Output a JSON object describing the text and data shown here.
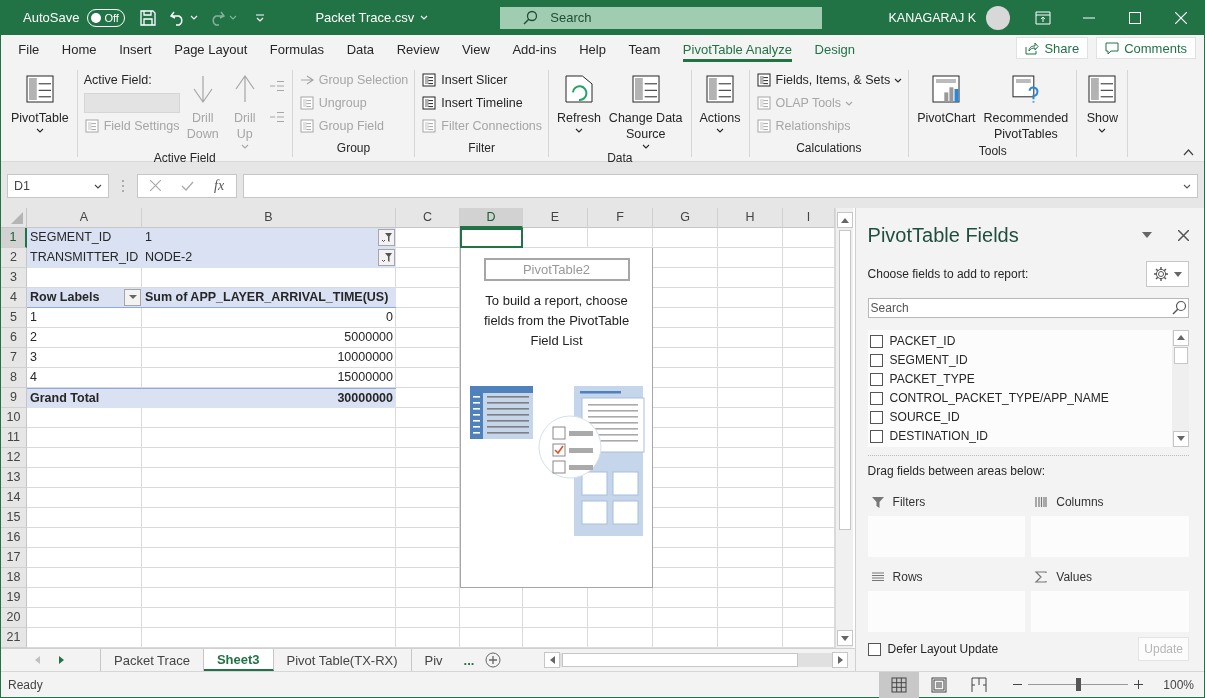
{
  "title_bar": {
    "autosave_label": "AutoSave",
    "autosave": {
      "on": false,
      "label": "Off"
    },
    "redo_disabled": true,
    "file_name": "Packet Trace.csv",
    "search": {
      "placeholder": "Search"
    },
    "user_name": "KANAGARAJ K"
  },
  "menu_tabs": [
    {
      "label": "File",
      "selected": false,
      "contextual": false
    },
    {
      "label": "Home",
      "selected": false,
      "contextual": false
    },
    {
      "label": "Insert",
      "selected": false,
      "contextual": false
    },
    {
      "label": "Page Layout",
      "selected": false,
      "contextual": false
    },
    {
      "label": "Formulas",
      "selected": false,
      "contextual": false
    },
    {
      "label": "Data",
      "selected": false,
      "contextual": false
    },
    {
      "label": "Review",
      "selected": false,
      "contextual": false
    },
    {
      "label": "View",
      "selected": false,
      "contextual": false
    },
    {
      "label": "Add-ins",
      "selected": false,
      "contextual": false
    },
    {
      "label": "Help",
      "selected": false,
      "contextual": false
    },
    {
      "label": "Team",
      "selected": false,
      "contextual": false
    },
    {
      "label": "PivotTable Analyze",
      "selected": true,
      "contextual": true
    },
    {
      "label": "Design",
      "selected": false,
      "contextual": true
    }
  ],
  "share": "Share",
  "comments": "Comments",
  "ribbon": {
    "groups": [
      {
        "columns": [
          [
            {
              "kind": "large",
              "lines": [
                "PivotTable"
              ],
              "dropdown": true,
              "disabled": false
            }
          ]
        ]
      },
      {
        "label": "Active Field",
        "columns": [
          [
            {
              "kind": "label",
              "text": "Active Field:"
            },
            {
              "kind": "input",
              "disabled": true
            },
            {
              "kind": "small",
              "text": "Field Settings",
              "disabled": true
            }
          ],
          [
            {
              "kind": "large",
              "lines": [
                "Drill",
                "Down"
              ],
              "disabled": true
            }
          ],
          [
            {
              "kind": "large",
              "lines": [
                "Drill",
                "Up"
              ],
              "dropdown": true,
              "disabled": true
            }
          ],
          [
            {
              "kind": "icon",
              "disabled": true
            },
            {
              "kind": "icon",
              "disabled": true
            }
          ]
        ]
      },
      {
        "label": "Group",
        "columns": [
          [
            {
              "kind": "small",
              "text": "Group Selection",
              "disabled": true
            },
            {
              "kind": "small",
              "text": "Ungroup",
              "disabled": true
            },
            {
              "kind": "small",
              "text": "Group Field",
              "disabled": true
            }
          ]
        ]
      },
      {
        "label": "Filter",
        "columns": [
          [
            {
              "kind": "small",
              "text": "Insert Slicer",
              "disabled": false
            },
            {
              "kind": "small",
              "text": "Insert Timeline",
              "disabled": false
            },
            {
              "kind": "small",
              "text": "Filter Connections",
              "disabled": true
            }
          ]
        ]
      },
      {
        "label": "Data",
        "columns": [
          [
            {
              "kind": "large",
              "lines": [
                "Refresh"
              ],
              "dropdown": true,
              "disabled": false
            }
          ],
          [
            {
              "kind": "large",
              "lines": [
                "Change Data",
                "Source"
              ],
              "dropdown": true,
              "disabled": false
            }
          ]
        ]
      },
      {
        "columns": [
          [
            {
              "kind": "large",
              "lines": [
                "Actions"
              ],
              "dropdown": true,
              "disabled": false
            }
          ]
        ]
      },
      {
        "label": "Calculations",
        "columns": [
          [
            {
              "kind": "small",
              "text": "Fields, Items, & Sets",
              "dropdown": true,
              "disabled": false
            },
            {
              "kind": "small",
              "text": "OLAP Tools",
              "dropdown": true,
              "disabled": true
            },
            {
              "kind": "small",
              "text": "Relationships",
              "disabled": true
            }
          ]
        ]
      },
      {
        "label": "Tools",
        "columns": [
          [
            {
              "kind": "large",
              "lines": [
                "PivotChart"
              ],
              "disabled": false
            }
          ],
          [
            {
              "kind": "large",
              "lines": [
                "Recommended",
                "PivotTables"
              ],
              "disabled": false
            }
          ]
        ]
      },
      {
        "columns": [
          [
            {
              "kind": "large",
              "lines": [
                "Show"
              ],
              "dropdown": true,
              "disabled": false
            }
          ]
        ]
      }
    ]
  },
  "formula_bar": {
    "name_box": "D1",
    "function_button": "fx"
  },
  "sheet": {
    "columns": [
      {
        "label": "A",
        "selected": false
      },
      {
        "label": "B",
        "selected": false
      },
      {
        "label": "C",
        "selected": false
      },
      {
        "label": "D",
        "selected": true
      },
      {
        "label": "E",
        "selected": false
      },
      {
        "label": "F",
        "selected": false
      },
      {
        "label": "G",
        "selected": false
      },
      {
        "label": "H",
        "selected": false
      },
      {
        "label": "I",
        "selected": false
      }
    ],
    "rows": [
      {
        "label": "1",
        "selected": true,
        "kind": "filter",
        "cells": [
          "SEGMENT_ID",
          "1"
        ]
      },
      {
        "label": "2",
        "selected": false,
        "kind": "filter",
        "cells": [
          "TRANSMITTER_ID",
          "NODE-2"
        ]
      },
      {
        "label": "3",
        "selected": false,
        "kind": "blank"
      },
      {
        "label": "4",
        "selected": false,
        "kind": "header",
        "cells": [
          "Row Labels",
          "Sum of APP_LAYER_ARRIVAL_TIME(US)"
        ]
      },
      {
        "label": "5",
        "selected": false,
        "kind": "item",
        "cells": [
          "1",
          "0"
        ]
      },
      {
        "label": "6",
        "selected": false,
        "kind": "item",
        "cells": [
          "2",
          "5000000"
        ]
      },
      {
        "label": "7",
        "selected": false,
        "kind": "item",
        "cells": [
          "3",
          "10000000"
        ]
      },
      {
        "label": "8",
        "selected": false,
        "kind": "item",
        "cells": [
          "4",
          "15000000"
        ]
      },
      {
        "label": "9",
        "selected": false,
        "kind": "total",
        "cells": [
          "Grand Total",
          "30000000"
        ]
      },
      {
        "label": "10",
        "selected": false,
        "kind": "blank"
      },
      {
        "label": "11",
        "selected": false,
        "kind": "blank"
      },
      {
        "label": "12",
        "selected": false,
        "kind": "blank"
      },
      {
        "label": "13",
        "selected": false,
        "kind": "blank"
      },
      {
        "label": "14",
        "selected": false,
        "kind": "blank"
      },
      {
        "label": "15",
        "selected": false,
        "kind": "blank"
      },
      {
        "label": "16",
        "selected": false,
        "kind": "blank"
      },
      {
        "label": "17",
        "selected": false,
        "kind": "blank"
      },
      {
        "label": "18",
        "selected": false,
        "kind": "blank"
      },
      {
        "label": "19",
        "selected": false,
        "kind": "blank"
      },
      {
        "label": "20",
        "selected": false,
        "kind": "blank"
      },
      {
        "label": "21",
        "selected": false,
        "kind": "blank"
      }
    ],
    "pivot_placeholder": {
      "name": "PivotTable2",
      "message": "To build a report, choose fields from the PivotTable Field List"
    }
  },
  "sheet_tabs": {
    "nav": [
      {
        "disabled": true
      },
      {
        "disabled": false
      }
    ],
    "tabs": [
      {
        "label": "Packet Trace",
        "selected": false
      },
      {
        "label": "Sheet3",
        "selected": true
      },
      {
        "label": "Pivot Table(TX-RX)",
        "selected": false
      },
      {
        "label": "Piv",
        "selected": false
      }
    ],
    "more": "..."
  },
  "field_panel": {
    "title": "PivotTable Fields",
    "subtitle": "Choose fields to add to report:",
    "search": {
      "placeholder": "Search"
    },
    "fields": [
      {
        "label": "PACKET_ID",
        "checked": false
      },
      {
        "label": "SEGMENT_ID",
        "checked": false
      },
      {
        "label": "PACKET_TYPE",
        "checked": false
      },
      {
        "label": "CONTROL_PACKET_TYPE/APP_NAME",
        "checked": false
      },
      {
        "label": "SOURCE_ID",
        "checked": false
      },
      {
        "label": "DESTINATION_ID",
        "checked": false
      }
    ],
    "areas_hint": "Drag fields between areas below:",
    "areas": [
      {
        "label": "Filters"
      },
      {
        "label": "Columns"
      },
      {
        "label": "Rows"
      },
      {
        "label": "Values"
      }
    ],
    "defer": {
      "label": "Defer Layout Update",
      "checked": false
    },
    "update": {
      "label": "Update",
      "disabled": true
    }
  },
  "status_bar": {
    "status": "Ready",
    "views": [
      {
        "selected": true
      },
      {
        "selected": false
      },
      {
        "selected": false
      }
    ],
    "zoom": {
      "level": 0.5,
      "label": "100%"
    }
  }
}
